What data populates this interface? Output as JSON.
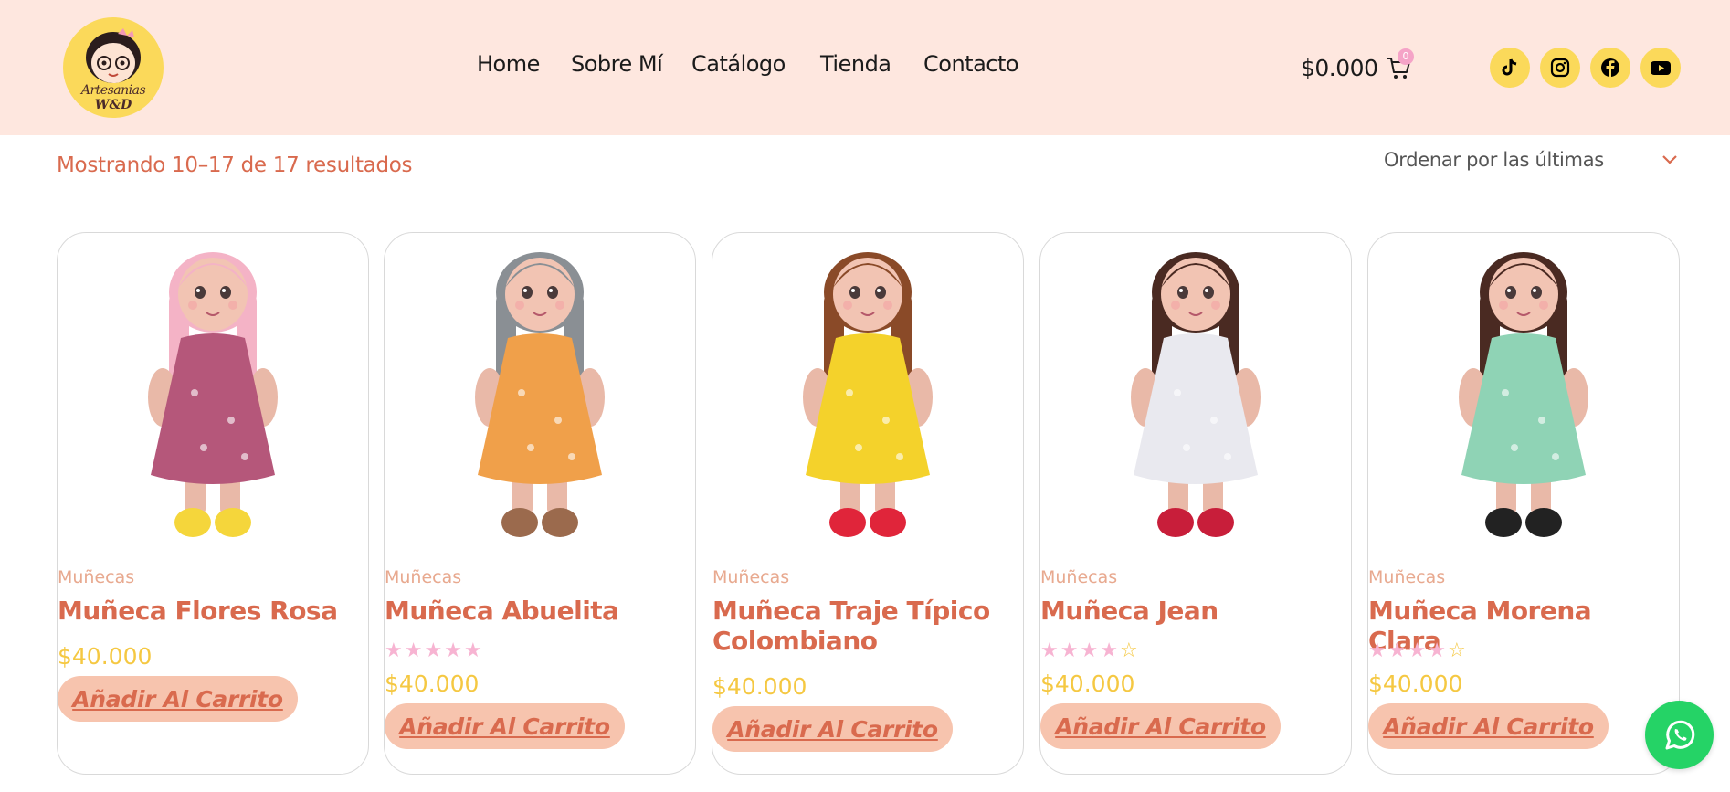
{
  "brand": {
    "logo_line1": "Artesanias",
    "logo_line2": "W&D"
  },
  "nav": [
    {
      "label": "Home"
    },
    {
      "label": "Sobre Mí"
    },
    {
      "label": "Catálogo"
    },
    {
      "label": "Tienda"
    },
    {
      "label": "Contacto"
    }
  ],
  "cart": {
    "amount": "$0.000",
    "count": "0"
  },
  "social": [
    {
      "icon": "tiktok-icon"
    },
    {
      "icon": "instagram-icon"
    },
    {
      "icon": "facebook-icon"
    },
    {
      "icon": "youtube-icon"
    }
  ],
  "toolbar": {
    "results_text": "Mostrando 10–17 de 17 resultados",
    "sort_label": "Ordenar por las últimas"
  },
  "products": [
    {
      "category": "Muñecas",
      "title": "Muñeca Flores Rosa",
      "rating": null,
      "price": "$40.000",
      "button": "Añadir Al Carrito",
      "hair": "#f4b3c6",
      "dress": "#b5577a",
      "shoes": "#f5d63b"
    },
    {
      "category": "Muñecas",
      "title": "Muñeca Abuelita",
      "rating": 5,
      "price": "$40.000",
      "button": "Añadir Al Carrito",
      "hair": "#8a8f94",
      "dress": "#f0a04a",
      "shoes": "#9b6a4d"
    },
    {
      "category": "Muñecas",
      "title": "Muñeca Traje Típico Colombiano",
      "rating": null,
      "price": "$40.000",
      "button": "Añadir Al Carrito",
      "hair": "#8a4a28",
      "dress": "#f4d22b",
      "shoes": "#e0253a"
    },
    {
      "category": "Muñecas",
      "title": "Muñeca Jean",
      "rating": 4,
      "price": "$40.000",
      "button": "Añadir Al Carrito",
      "hair": "#4a2a22",
      "dress": "#e9e9ef",
      "shoes": "#c81e3a"
    },
    {
      "category": "Muñecas",
      "title": "Muñeca Morena Clara",
      "rating": 4,
      "price": "$40.000",
      "button": "Añadir Al Carrito",
      "hair": "#4a2a22",
      "dress": "#8fd3b5",
      "shoes": "#222222"
    }
  ],
  "colors": {
    "header_bg": "#fee7df",
    "accent": "#d96a4e",
    "price": "#f5c842",
    "button_bg": "#f7c4ae",
    "social_bg": "#fbd95a",
    "whatsapp": "#25d366"
  }
}
